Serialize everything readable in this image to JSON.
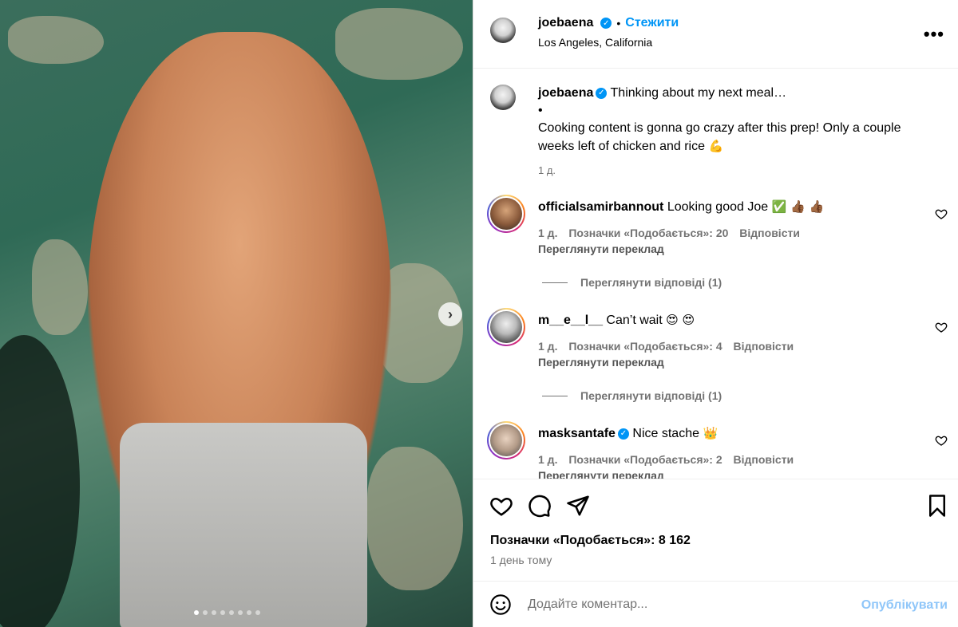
{
  "post": {
    "author": "joebaena",
    "follow_label": "Стежити",
    "location": "Los Angeles, California",
    "more_label": "•••",
    "caption_line1": "Thinking about my next meal…",
    "caption_bullet": "•",
    "caption_body": "Cooking content is gonna go crazy after this prep! Only a couple weeks left of chicken and rice",
    "caption_emoji": "💪",
    "caption_time": "1 д.",
    "likes": "Позначки «Подобається»: 8 162",
    "date": "1 день тому",
    "media_dots": 8,
    "media_active_dot": 0
  },
  "comments": [
    {
      "user": "officialsamirbannout",
      "verified": false,
      "text": "Looking good Joe",
      "emoji": "✅ 👍🏾 👍🏾",
      "time": "1 д.",
      "likes": "Позначки «Подобається»: 20",
      "reply": "Відповісти",
      "translate": "Переглянути переклад",
      "view_replies": "Переглянути відповіді (1)"
    },
    {
      "user": "m__e__l__",
      "verified": false,
      "text": "Can’t wait",
      "emoji": "😍 😍",
      "time": "1 д.",
      "likes": "Позначки «Подобається»: 4",
      "reply": "Відповісти",
      "translate": "Переглянути переклад",
      "view_replies": "Переглянути відповіді (1)"
    },
    {
      "user": "masksantafe",
      "verified": true,
      "text": "Nice stache",
      "emoji": "👑",
      "time": "1 д.",
      "likes": "Позначки «Подобається»: 2",
      "reply": "Відповісти",
      "translate": "Переглянути переклад"
    }
  ],
  "comment_box": {
    "placeholder": "Додайте коментар...",
    "publish_label": "Опублікувати"
  },
  "icons": {
    "verified": "verified-badge-icon",
    "next": "chevron-right-icon",
    "like": "heart-icon",
    "comment": "comment-icon",
    "share": "paper-plane-icon",
    "save": "bookmark-icon",
    "emoji": "smiley-icon"
  },
  "colors": {
    "accent": "#0095f6",
    "publish_disabled": "#8fc6f9",
    "secondary_text": "#737373"
  }
}
